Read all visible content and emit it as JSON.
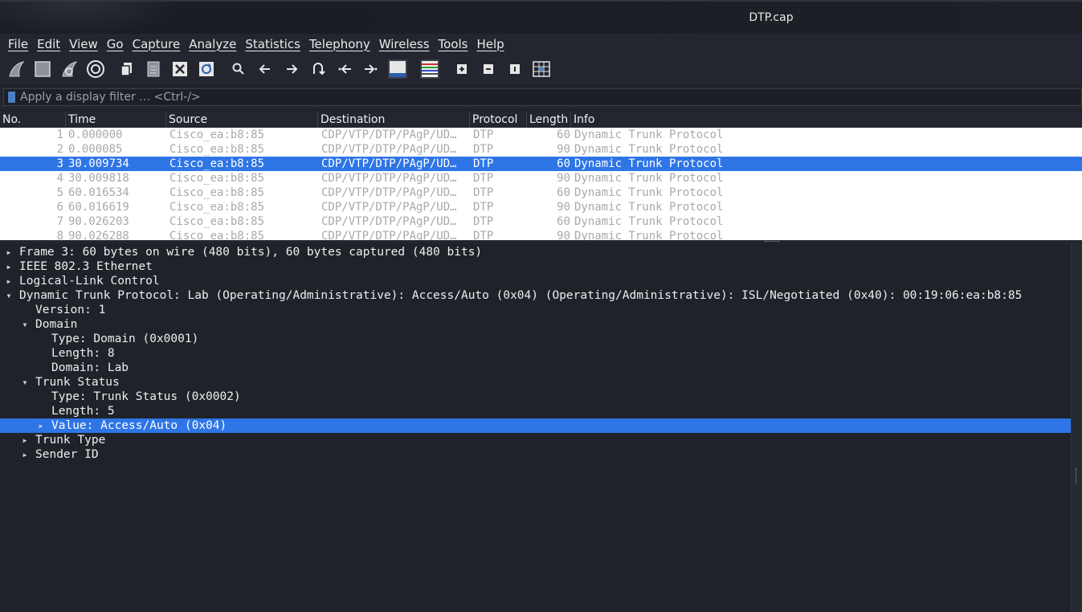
{
  "window": {
    "title": "DTP.cap"
  },
  "menu": [
    "File",
    "Edit",
    "View",
    "Go",
    "Capture",
    "Analyze",
    "Statistics",
    "Telephony",
    "Wireless",
    "Tools",
    "Help"
  ],
  "toolbar": {
    "icons": [
      "shark-fin-start-icon",
      "stop-square-icon",
      "shark-fin-restart-icon",
      "gear-options-icon",
      "open-file-icon",
      "save-file-icon",
      "close-file-icon",
      "reload-icon",
      "search-icon",
      "arrow-left-icon",
      "arrow-right-icon",
      "jump-to-icon",
      "first-packet-icon",
      "last-packet-icon",
      "autoscroll-icon",
      "colorize-icon",
      "zoom-in-icon",
      "zoom-out-icon",
      "zoom-normal-icon",
      "resize-columns-icon"
    ]
  },
  "filter": {
    "placeholder": "Apply a display filter … <Ctrl-/>"
  },
  "packet_list": {
    "columns": [
      "No.",
      "Time",
      "Source",
      "Destination",
      "Protocol",
      "Length",
      "Info"
    ],
    "rows": [
      {
        "no": "1",
        "time": "0.000000",
        "source": "Cisco_ea:b8:85",
        "destination": "CDP/VTP/DTP/PAgP/UD…",
        "protocol": "DTP",
        "length": "60",
        "info": "Dynamic Trunk Protocol"
      },
      {
        "no": "2",
        "time": "0.000085",
        "source": "Cisco_ea:b8:85",
        "destination": "CDP/VTP/DTP/PAgP/UD…",
        "protocol": "DTP",
        "length": "90",
        "info": "Dynamic Trunk Protocol"
      },
      {
        "no": "3",
        "time": "30.009734",
        "source": "Cisco_ea:b8:85",
        "destination": "CDP/VTP/DTP/PAgP/UD…",
        "protocol": "DTP",
        "length": "60",
        "info": "Dynamic Trunk Protocol",
        "selected": true
      },
      {
        "no": "4",
        "time": "30.009818",
        "source": "Cisco_ea:b8:85",
        "destination": "CDP/VTP/DTP/PAgP/UD…",
        "protocol": "DTP",
        "length": "90",
        "info": "Dynamic Trunk Protocol"
      },
      {
        "no": "5",
        "time": "60.016534",
        "source": "Cisco_ea:b8:85",
        "destination": "CDP/VTP/DTP/PAgP/UD…",
        "protocol": "DTP",
        "length": "60",
        "info": "Dynamic Trunk Protocol"
      },
      {
        "no": "6",
        "time": "60.016619",
        "source": "Cisco_ea:b8:85",
        "destination": "CDP/VTP/DTP/PAgP/UD…",
        "protocol": "DTP",
        "length": "90",
        "info": "Dynamic Trunk Protocol"
      },
      {
        "no": "7",
        "time": "90.026203",
        "source": "Cisco_ea:b8:85",
        "destination": "CDP/VTP/DTP/PAgP/UD…",
        "protocol": "DTP",
        "length": "60",
        "info": "Dynamic Trunk Protocol"
      },
      {
        "no": "8",
        "time": "90.026288",
        "source": "Cisco_ea:b8:85",
        "destination": "CDP/VTP/DTP/PAgP/UD…",
        "protocol": "DTP",
        "length": "90",
        "info": "Dynamic Trunk Protocol"
      }
    ]
  },
  "details": [
    {
      "level": 0,
      "arrow": "collapsed",
      "text": "Frame 3: 60 bytes on wire (480 bits), 60 bytes captured (480 bits)"
    },
    {
      "level": 0,
      "arrow": "collapsed",
      "text": "IEEE 802.3 Ethernet"
    },
    {
      "level": 0,
      "arrow": "collapsed",
      "text": "Logical-Link Control"
    },
    {
      "level": 0,
      "arrow": "expanded",
      "text": "Dynamic Trunk Protocol: Lab (Operating/Administrative): Access/Auto (0x04) (Operating/Administrative): ISL/Negotiated (0x40): 00:19:06:ea:b8:85"
    },
    {
      "level": 1,
      "arrow": "none",
      "text": "Version: 1"
    },
    {
      "level": 1,
      "arrow": "expanded",
      "text": "Domain"
    },
    {
      "level": 2,
      "arrow": "none",
      "text": "Type: Domain (0x0001)"
    },
    {
      "level": 2,
      "arrow": "none",
      "text": "Length: 8"
    },
    {
      "level": 2,
      "arrow": "none",
      "text": "Domain: Lab"
    },
    {
      "level": 1,
      "arrow": "expanded",
      "text": "Trunk Status"
    },
    {
      "level": 2,
      "arrow": "none",
      "text": "Type: Trunk Status (0x0002)"
    },
    {
      "level": 2,
      "arrow": "none",
      "text": "Length: 5"
    },
    {
      "level": 2,
      "arrow": "collapsed",
      "text": "Value: Access/Auto (0x04)",
      "selected": true
    },
    {
      "level": 1,
      "arrow": "collapsed",
      "text": "Trunk Type"
    },
    {
      "level": 1,
      "arrow": "collapsed",
      "text": "Sender ID"
    }
  ],
  "colors": {
    "selection": "#2e75e6",
    "background": "#1f2229",
    "packet_list_bg": "#ffffff",
    "dim_text": "#a9a9a9"
  }
}
